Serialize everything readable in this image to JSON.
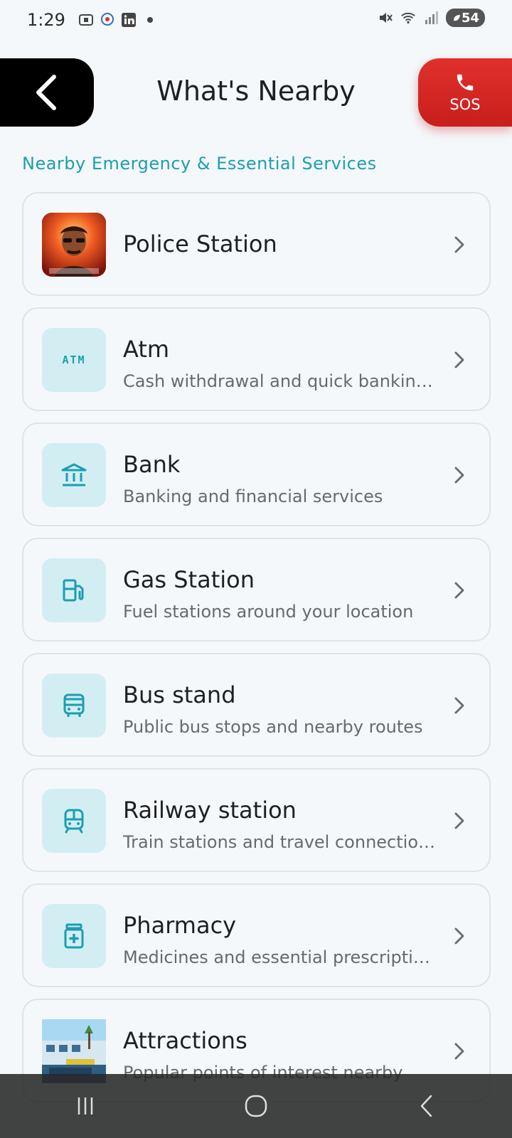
{
  "status_bar": {
    "time": "1:29",
    "battery": "54"
  },
  "header": {
    "title": "What's Nearby",
    "sos_label": "SOS"
  },
  "section": {
    "title": "Nearby Emergency & Essential Services"
  },
  "items": [
    {
      "title": "Police Station",
      "subtitle": "",
      "icon": "police-photo"
    },
    {
      "title": "Atm",
      "subtitle": "Cash withdrawal and quick banking...",
      "icon": "atm-icon",
      "icon_text": "ATM"
    },
    {
      "title": "Bank",
      "subtitle": "Banking and financial services",
      "icon": "bank-icon"
    },
    {
      "title": "Gas Station",
      "subtitle": "Fuel stations around your location",
      "icon": "gas-station-icon"
    },
    {
      "title": "Bus stand",
      "subtitle": "Public bus stops and nearby routes",
      "icon": "bus-icon"
    },
    {
      "title": "Railway station",
      "subtitle": "Train stations and travel connections",
      "icon": "train-icon"
    },
    {
      "title": "Pharmacy",
      "subtitle": "Medicines and essential prescriptio...",
      "icon": "pharmacy-icon"
    },
    {
      "title": "Attractions",
      "subtitle": "Popular points of interest nearby",
      "icon": "attractions-photo"
    }
  ],
  "colors": {
    "accent": "#1a9eb3",
    "sos": "#d42a26",
    "icon_bg": "#d3eef3"
  }
}
